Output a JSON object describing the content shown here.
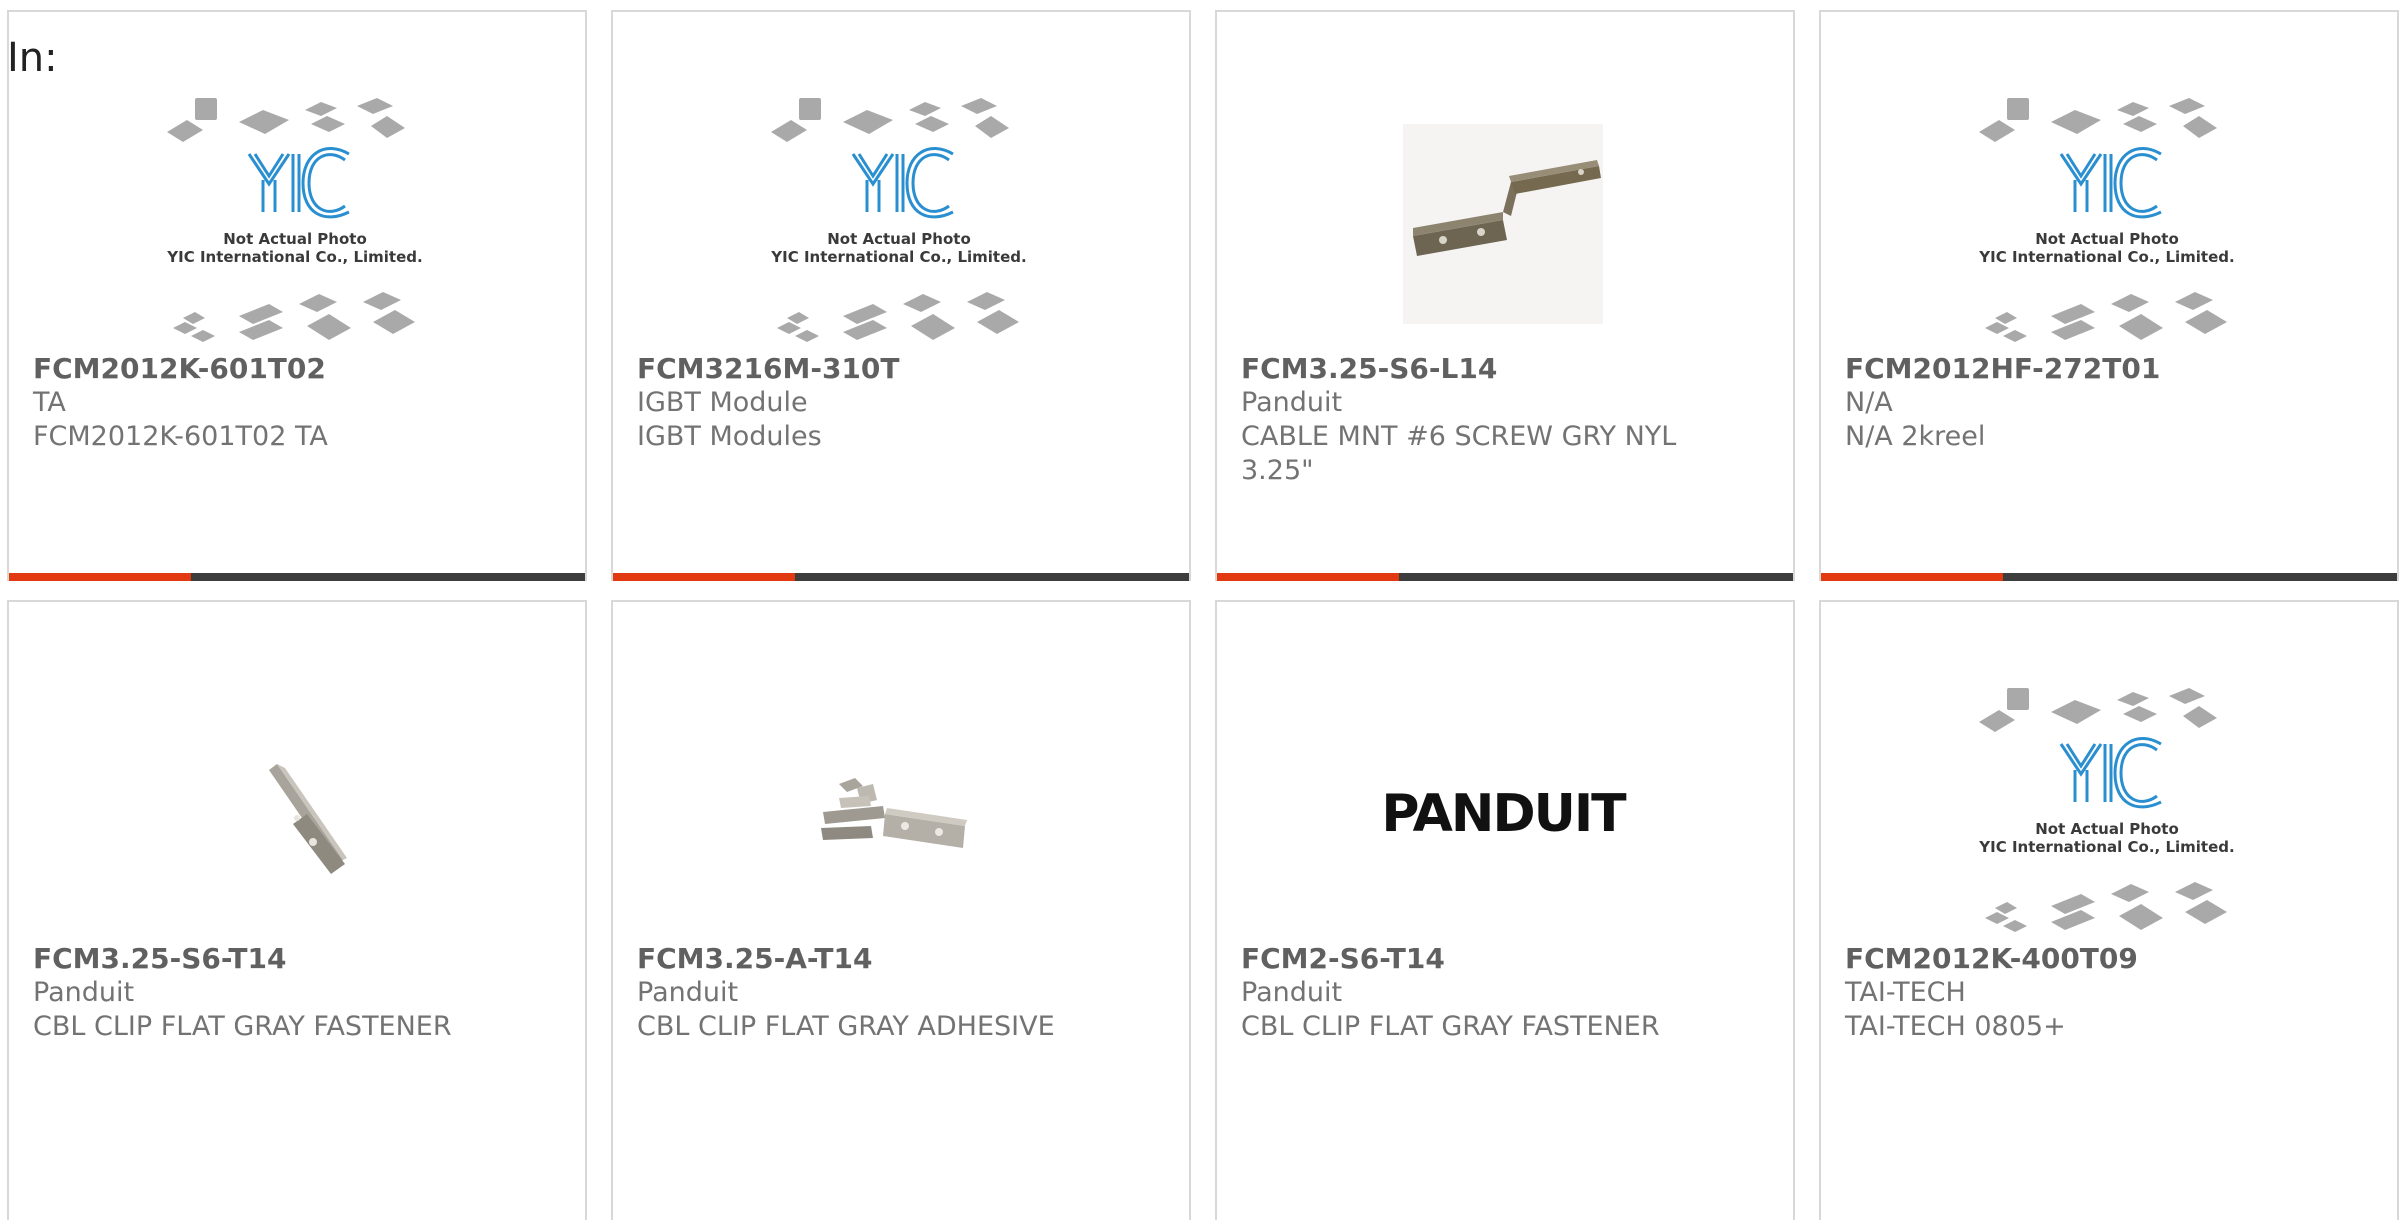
{
  "heading": "In:",
  "colors": {
    "accent": "#e13a12",
    "bar": "#3d3d3d",
    "border": "#d8d8d8"
  },
  "placeholder": {
    "logo": "YIC",
    "note_line1": "Not Actual Photo",
    "note_line2": "YIC International Co., Limited."
  },
  "brand_logo": "PANDUIT",
  "products": [
    {
      "part": "FCM2012K-601T02",
      "brand": "TA",
      "desc": "FCM2012K-601T02 TA",
      "image": "yic-placeholder"
    },
    {
      "part": "FCM3216M-310T",
      "brand": "IGBT Module",
      "desc": "IGBT Modules",
      "image": "yic-placeholder"
    },
    {
      "part": "FCM3.25-S6-L14",
      "brand": "Panduit",
      "desc_line1": "CABLE MNT #6 SCREW GRY NYL",
      "desc_line2": "3.25\"",
      "image": "cable-mount-photo"
    },
    {
      "part": "FCM2012HF-272T01",
      "brand": "N/A",
      "desc": "N/A 2kreel",
      "image": "yic-placeholder"
    },
    {
      "part": "FCM3.25-S6-T14",
      "brand": "Panduit",
      "desc": "CBL CLIP FLAT GRAY FASTENER",
      "image": "cable-clip-photo"
    },
    {
      "part": "FCM3.25-A-T14",
      "brand": "Panduit",
      "desc": "CBL CLIP FLAT GRAY ADHESIVE",
      "image": "cable-clip-set-photo"
    },
    {
      "part": "FCM2-S6-T14",
      "brand": "Panduit",
      "desc": "CBL CLIP FLAT GRAY FASTENER",
      "image": "panduit-logo"
    },
    {
      "part": "FCM2012K-400T09",
      "brand": "TAI-TECH",
      "desc": "TAI-TECH 0805+",
      "image": "yic-placeholder"
    }
  ]
}
